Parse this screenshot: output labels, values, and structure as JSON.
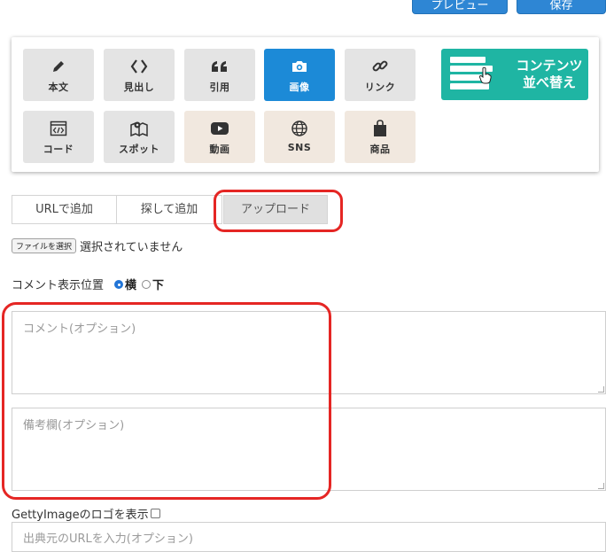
{
  "header": {
    "preview_label": "プレビュー",
    "save_label": "保存"
  },
  "palette": {
    "blocks": [
      {
        "label": "本文",
        "icon": "pen-icon"
      },
      {
        "label": "見出し",
        "icon": "code-brackets-icon"
      },
      {
        "label": "引用",
        "icon": "quote-icon"
      },
      {
        "label": "画像",
        "icon": "camera-icon",
        "active": true
      },
      {
        "label": "リンク",
        "icon": "link-icon"
      },
      {
        "label": "コード",
        "icon": "code-window-icon"
      },
      {
        "label": "スポット",
        "icon": "map-pin-icon"
      },
      {
        "label": "動画",
        "icon": "youtube-icon"
      },
      {
        "label": "SNS",
        "icon": "globe-icon"
      },
      {
        "label": "商品",
        "icon": "shopping-bag-icon"
      }
    ],
    "reorder": {
      "line1": "コンテンツ",
      "line2": "並べ替え"
    }
  },
  "tabs": [
    {
      "label": "URLで追加"
    },
    {
      "label": "探して追加"
    },
    {
      "label": "アップロード",
      "active": true
    }
  ],
  "file": {
    "button_label": "ファイルを選択",
    "status": "選択されていません"
  },
  "comment_position": {
    "label": "コメント表示位置",
    "options": [
      "横",
      "下"
    ],
    "selected": "横"
  },
  "comment_field": {
    "placeholder": "コメント(オプション)"
  },
  "note_field": {
    "placeholder": "備考欄(オプション)"
  },
  "getty": {
    "label": "GettyImageのロゴを表示",
    "checked": false
  },
  "source_field": {
    "placeholder": "出典元のURLを入力(オプション)"
  },
  "colors": {
    "accent": "#1c8ad7",
    "reorder": "#1fb5a3",
    "highlight": "#e52624",
    "media_bg": "#f1e8df"
  }
}
